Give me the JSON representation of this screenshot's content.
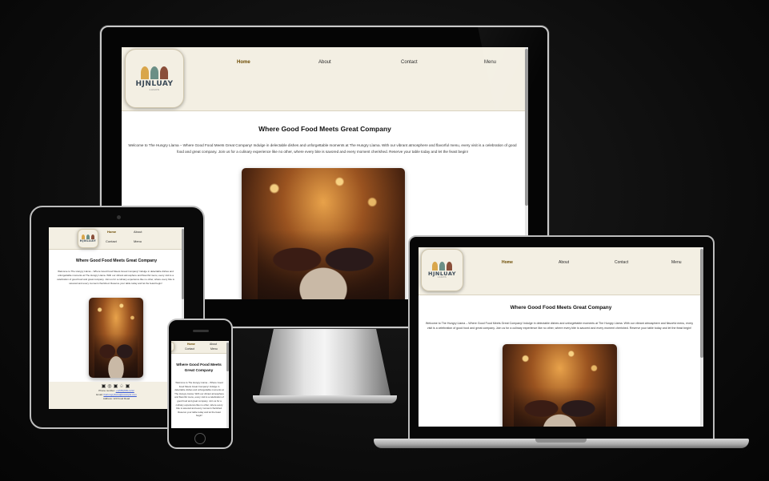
{
  "brand": {
    "logo_text": "HJNLUAY",
    "logo_sub": "LAGOS"
  },
  "nav": {
    "home": "Home",
    "about": "About",
    "contact": "Contact",
    "menu": "Menu"
  },
  "content": {
    "headline": "Where Good Food Meets Great Company",
    "intro": "Welcome to The Hungry Llama – Where Good Food Meets Great Company! Indulge in delectable dishes and unforgettable moments at The Hungry Llama. With our vibrant atmosphere and flavorful menu, every visit is a celebration of good food and great company. Join us for a culinary experience like no other, where every bite is savored and every moment cherished. Reserve your table today and let the feast begin!"
  },
  "footer": {
    "phone_label": "Phone number:",
    "phone_value": "+1(555)555-1212",
    "email_label": "Email:",
    "email_value": "thehungryllama@example.com",
    "address": "Address: 123 Food Road"
  },
  "colors": {
    "header_bg": "#f3efe3",
    "active_nav": "#6b4a00",
    "page_bg": "#0b0b0b"
  }
}
